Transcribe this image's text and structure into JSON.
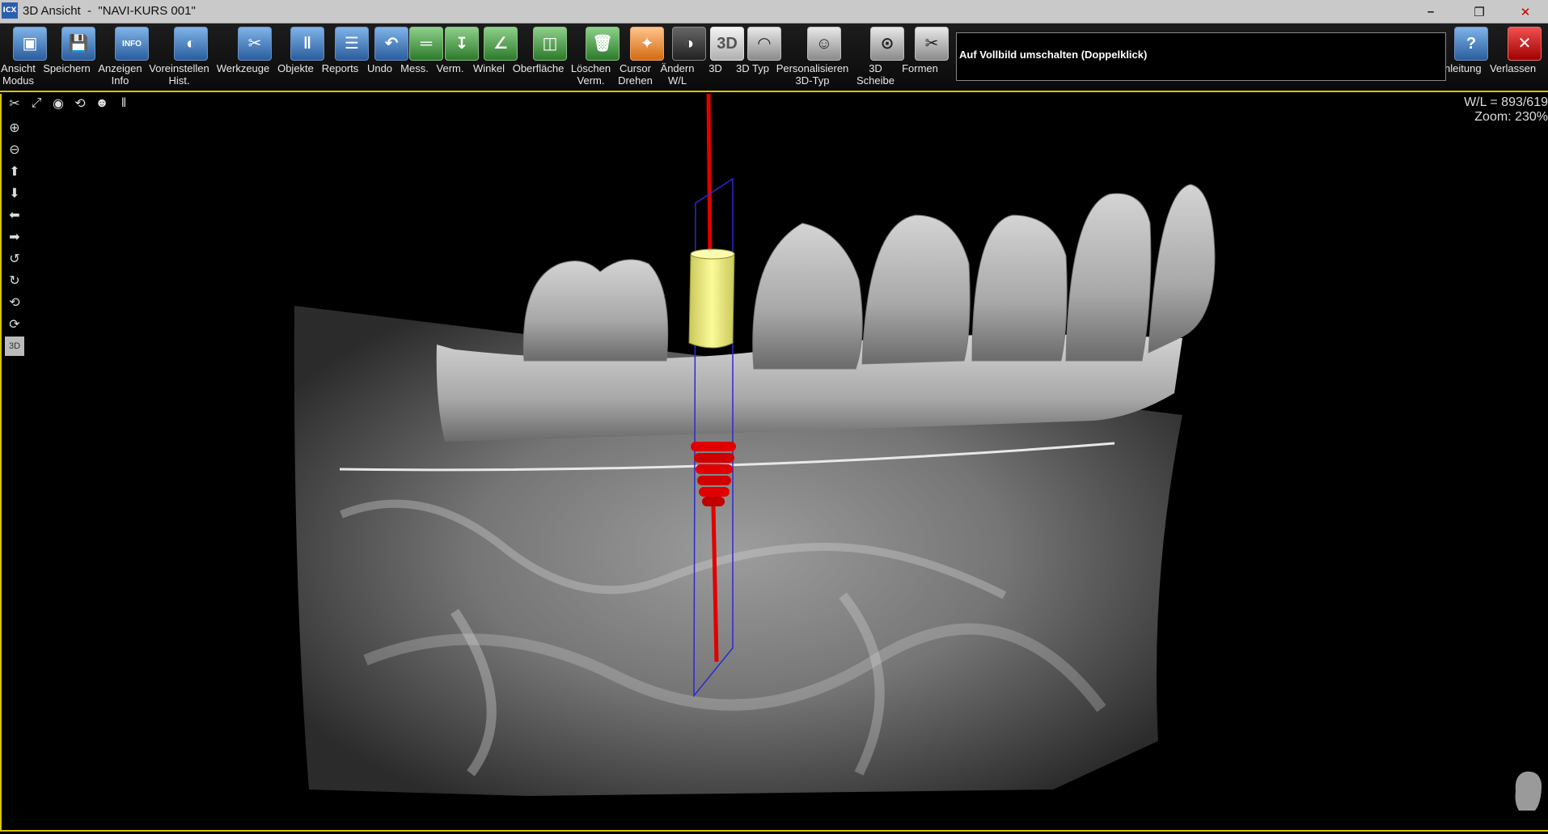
{
  "window": {
    "logo": "ICX",
    "title": "3D Ansicht  -  \"NAVI-KURS 001\"",
    "minimize_icon": "minimize-icon",
    "restore_icon": "restore-icon",
    "close_icon": "close-icon"
  },
  "toolbar": {
    "items": [
      {
        "label": "Ansicht\nModus",
        "icon": "view-mode-icon"
      },
      {
        "label": "Speichern",
        "icon": "save-icon"
      },
      {
        "label": "Anzeigen\nInfo",
        "icon": "info-icon",
        "glyph": "INFO"
      },
      {
        "label": "Voreinstellen\nHist.",
        "icon": "histogram-preset-icon"
      },
      {
        "label": "Werkzeuge",
        "icon": "tools-icon"
      },
      {
        "label": "Objekte",
        "icon": "implant-object-icon"
      },
      {
        "label": "Reports",
        "icon": "reports-icon"
      },
      {
        "label": "Undo",
        "icon": "undo-icon"
      },
      {
        "label": "Mess.",
        "icon": "measure-icon"
      },
      {
        "label": "Verm.",
        "icon": "dimension-icon"
      },
      {
        "label": "Winkel",
        "icon": "angle-icon"
      },
      {
        "label": "Oberfläche",
        "icon": "surface-icon"
      },
      {
        "label": "Löschen\nVerm.",
        "icon": "delete-icon"
      },
      {
        "label": "Cursor\nDrehen",
        "icon": "rotate-cursor-icon"
      },
      {
        "label": "Ändern\nW/L",
        "icon": "window-level-icon"
      },
      {
        "label": "3D",
        "icon": "3d-icon",
        "glyph": "3D"
      },
      {
        "label": "3D Typ",
        "icon": "3d-type-icon"
      },
      {
        "label": "Personalisieren\n3D-Typ",
        "icon": "personalize-3d-icon"
      },
      {
        "label": "3D\nScheibe",
        "icon": "3d-slice-icon"
      },
      {
        "label": "Formen",
        "icon": "scissors-icon"
      },
      {
        "label": "Anleitung",
        "icon": "help-icon",
        "glyph": "?"
      },
      {
        "label": "Verlassen",
        "icon": "exit-icon",
        "glyph": "✕"
      }
    ],
    "info_text": "Auf Vollbild umschalten (Doppelklick)"
  },
  "viewport": {
    "wl": "W/L = 893/619",
    "zoom": "Zoom: 230%",
    "side_tools": [
      "zoom-in-icon",
      "zoom-out-icon",
      "pan-up-icon",
      "pan-down-icon",
      "pan-left-icon",
      "pan-right-icon",
      "rotate-left-icon",
      "rotate-right-icon",
      "rotate-x-icon",
      "rotate-y-icon",
      "3d-mode-icon"
    ],
    "top_tools": [
      "select-tool-icon",
      "fullscreen-icon",
      "camera-icon",
      "reset-icon",
      "head-icon",
      "implant-icon"
    ],
    "side_3d_label": "3D"
  }
}
